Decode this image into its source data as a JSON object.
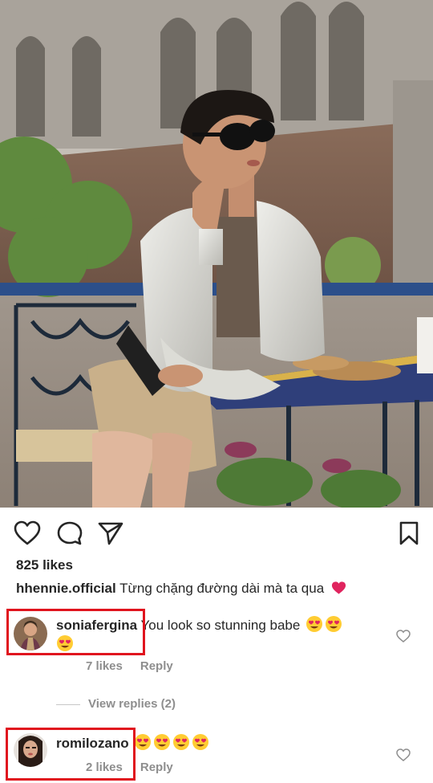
{
  "post": {
    "likes_text": "825 likes",
    "caption_user": "hhennie.official",
    "caption_text": "Từng chặng đường dài mà ta qua",
    "caption_emoji": "red-heart-icon"
  },
  "actions": {
    "like_icon": "heart-outline-icon",
    "comment_icon": "comment-bubble-icon",
    "share_icon": "paper-plane-icon",
    "save_icon": "bookmark-icon"
  },
  "comments": [
    {
      "user": "soniafergina",
      "text": "You look so stunning babe",
      "emojis": [
        "heart-eyes-emoji",
        "heart-eyes-emoji",
        "heart-eyes-emoji"
      ],
      "likes": "7 likes",
      "reply_label": "Reply"
    },
    {
      "user": "romilozano",
      "text": "",
      "emojis": [
        "heart-eyes-emoji",
        "heart-eyes-emoji",
        "heart-eyes-emoji",
        "heart-eyes-emoji"
      ],
      "likes": "2 likes",
      "reply_label": "Reply"
    }
  ],
  "view_replies_label": "View replies (2)",
  "colors": {
    "text": "#262626",
    "muted": "#8e8e8e",
    "highlight_box": "#e0141e",
    "emoji_heart": "#e0245e"
  }
}
